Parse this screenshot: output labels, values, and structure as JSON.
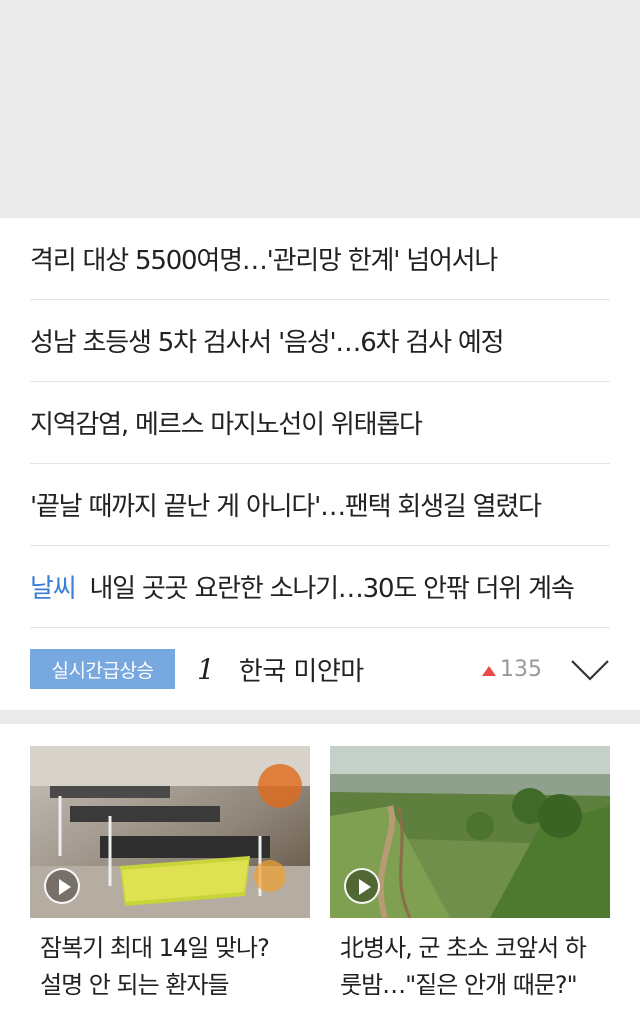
{
  "news": [
    {
      "text": "격리 대상 5500여명…'관리망 한계' 넘어서나"
    },
    {
      "text": "성남 초등생 5차 검사서 '음성'…6차 검사 예정"
    },
    {
      "text": "지역감염, 메르스 마지노선이 위태롭다"
    },
    {
      "text": "'끝날 때까지 끝난 게 아니다'…팬택 회생길 열렸다"
    },
    {
      "category": "날씨",
      "text": "내일 곳곳 요란한 소나기…30도 안팎 더위 계속"
    }
  ],
  "realtime": {
    "badge": "실시간급상승",
    "rank": "1",
    "keyword": "한국 미얀마",
    "count": "135",
    "up_color": "#e84a4a"
  },
  "cards": [
    {
      "title_line1": "잠복기 최대 14일 맞나?",
      "title_line2": "설명 안 되는 환자들",
      "thumb_icon": "play-icon"
    },
    {
      "title_line1": "北병사, 군 초소 코앞서 하",
      "title_line2": "룻밤…\"짙은 안개 때문?\"",
      "thumb_icon": "play-icon"
    }
  ]
}
